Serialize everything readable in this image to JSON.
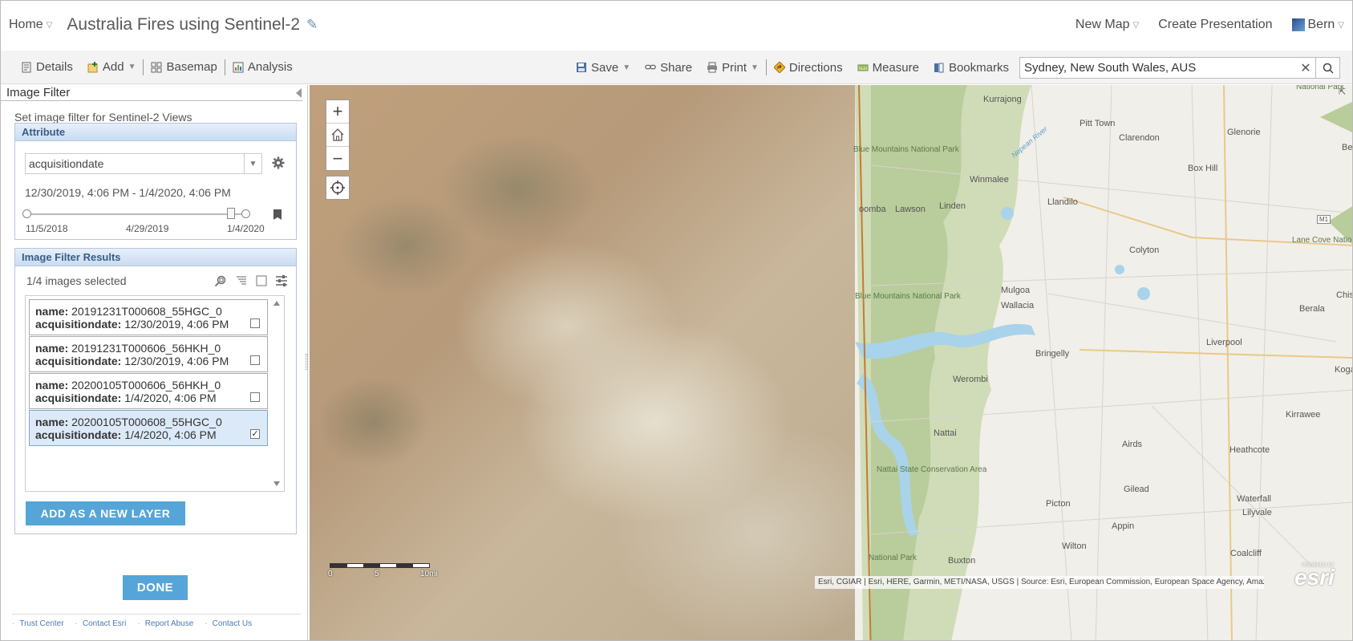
{
  "header": {
    "home_label": "Home",
    "map_title": "Australia Fires using Sentinel-2",
    "new_map_label": "New Map",
    "create_presentation_label": "Create Presentation",
    "user_label": "Bern"
  },
  "toolbar": {
    "details_label": "Details",
    "add_label": "Add",
    "basemap_label": "Basemap",
    "analysis_label": "Analysis",
    "save_label": "Save",
    "share_label": "Share",
    "print_label": "Print",
    "directions_label": "Directions",
    "measure_label": "Measure",
    "bookmarks_label": "Bookmarks",
    "search_value": "Sydney, New South Wales, AUS"
  },
  "panel": {
    "title": "Image Filter",
    "subtitle": "Set image filter for Sentinel-2 Views",
    "attribute": {
      "heading": "Attribute",
      "field_value": "acquisitiondate",
      "date_range": "12/30/2019, 4:06 PM - 1/4/2020, 4:06 PM",
      "ticks": [
        "11/5/2018",
        "4/29/2019",
        "1/4/2020"
      ]
    },
    "results": {
      "heading": "Image Filter Results",
      "count_text": "1/4 images selected",
      "name_key": "name:",
      "date_key": "acquisitiondate:",
      "items": [
        {
          "name": "20191231T000608_55HGC_0",
          "date": "12/30/2019, 4:06 PM",
          "checked": false
        },
        {
          "name": "20191231T000606_56HKH_0",
          "date": "12/30/2019, 4:06 PM",
          "checked": false
        },
        {
          "name": "20200105T000606_56HKH_0",
          "date": "1/4/2020, 4:06 PM",
          "checked": false
        },
        {
          "name": "20200105T000608_55HGC_0",
          "date": "1/4/2020, 4:06 PM",
          "checked": true
        }
      ],
      "add_layer_label": "ADD AS A NEW LAYER"
    },
    "done_label": "DONE",
    "footer_links": [
      "Trust Center",
      "Contact Esri",
      "Report Abuse",
      "Contact Us"
    ]
  },
  "map": {
    "scale_labels": [
      "0",
      "5",
      "10mi"
    ],
    "attribution": "Esri, CGIAR | Esri, HERE, Garmin, METI/NASA, USGS | Source: Esri, European Commission, European Space Agency, Amazon ...",
    "powered_by": "POWERED BY",
    "esri": "esri",
    "places": [
      {
        "id": "kurrajong",
        "label": "Kurrajong"
      },
      {
        "id": "blue-mountains-np-1",
        "label": "Blue Mountains National Park"
      },
      {
        "id": "pitt-town",
        "label": "Pitt Town"
      },
      {
        "id": "glenorie",
        "label": "Glenorie"
      },
      {
        "id": "clarendon",
        "label": "Clarendon"
      },
      {
        "id": "box-hill",
        "label": "Box Hill"
      },
      {
        "id": "winmalee",
        "label": "Winmalee"
      },
      {
        "id": "oomba",
        "label": "oomba"
      },
      {
        "id": "lawson",
        "label": "Lawson"
      },
      {
        "id": "linden",
        "label": "Linden"
      },
      {
        "id": "llandilo",
        "label": "Llandilo"
      },
      {
        "id": "colyton",
        "label": "Colyton"
      },
      {
        "id": "lane-cove-np",
        "label": "Lane Cove National Park"
      },
      {
        "id": "mulgoa",
        "label": "Mulgoa"
      },
      {
        "id": "blue-mountains-np-2",
        "label": "Blue Mountains National Park"
      },
      {
        "id": "wallacia",
        "label": "Wallacia"
      },
      {
        "id": "berala",
        "label": "Berala"
      },
      {
        "id": "bringelly",
        "label": "Bringelly"
      },
      {
        "id": "liverpool",
        "label": "Liverpool"
      },
      {
        "id": "werombi",
        "label": "Werombi"
      },
      {
        "id": "kogar",
        "label": "Kogar"
      },
      {
        "id": "kirrawee",
        "label": "Kirrawee"
      },
      {
        "id": "nattai",
        "label": "Nattai"
      },
      {
        "id": "airds",
        "label": "Airds"
      },
      {
        "id": "heathcote",
        "label": "Heathcote"
      },
      {
        "id": "nattai-scr",
        "label": "Nattai State Conservation Area"
      },
      {
        "id": "waterfall",
        "label": "Waterfall"
      },
      {
        "id": "gilead",
        "label": "Gilead"
      },
      {
        "id": "picton",
        "label": "Picton"
      },
      {
        "id": "lilyvale",
        "label": "Lilyvale"
      },
      {
        "id": "appin",
        "label": "Appin"
      },
      {
        "id": "wilton",
        "label": "Wilton"
      },
      {
        "id": "coalcliff",
        "label": "Coalcliff"
      },
      {
        "id": "buxton",
        "label": "Buxton"
      },
      {
        "id": "national-park-s",
        "label": "National Park"
      },
      {
        "id": "nepean-river",
        "label": "Nepean River"
      },
      {
        "id": "national-park-n",
        "label": "National Park"
      },
      {
        "id": "be",
        "label": "Be"
      },
      {
        "id": "chisw",
        "label": "Chisw"
      },
      {
        "id": "m1",
        "label": "M1"
      }
    ]
  }
}
